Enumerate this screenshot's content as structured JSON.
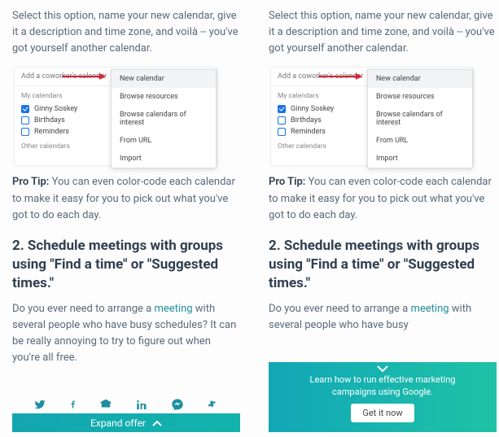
{
  "intro": "Select this option, name your new calendar, give it a description and time zone, and voilà -- you've got yourself another calendar.",
  "proTip": {
    "label": "Pro Tip:",
    "text": " You can even color-code each calendar to make it easy for you to pick out what you've got to do each day."
  },
  "heading": "2. Schedule meetings with groups using \"Find a time\" or \"Suggested times.\"",
  "para2_left": {
    "a": "Do you ever need to arrange a ",
    "link": "meeting",
    "b": " with several people who have busy schedules? It can be really annoying to try to figure out when you're all free."
  },
  "para2_right": {
    "a": "Do you ever need to arrange a ",
    "link": "meeting",
    "b": " with several people who have busy"
  },
  "shot": {
    "add_label": "Add a coworker's calendar",
    "mycal_label": "My calendars",
    "rows": [
      "Ginny Soskey",
      "Birthdays",
      "Reminders"
    ],
    "othercal_label": "Other calendars",
    "menu": [
      "New calendar",
      "Browse resources",
      "Browse calendars of interest",
      "From URL",
      "Import"
    ]
  },
  "bar1": "Expand offer",
  "bar2": {
    "text": "Learn how to run effective marketing campaigns using Google.",
    "cta": "Get it now"
  },
  "social": [
    "twitter",
    "facebook",
    "email",
    "linkedin",
    "messenger",
    "slack"
  ]
}
